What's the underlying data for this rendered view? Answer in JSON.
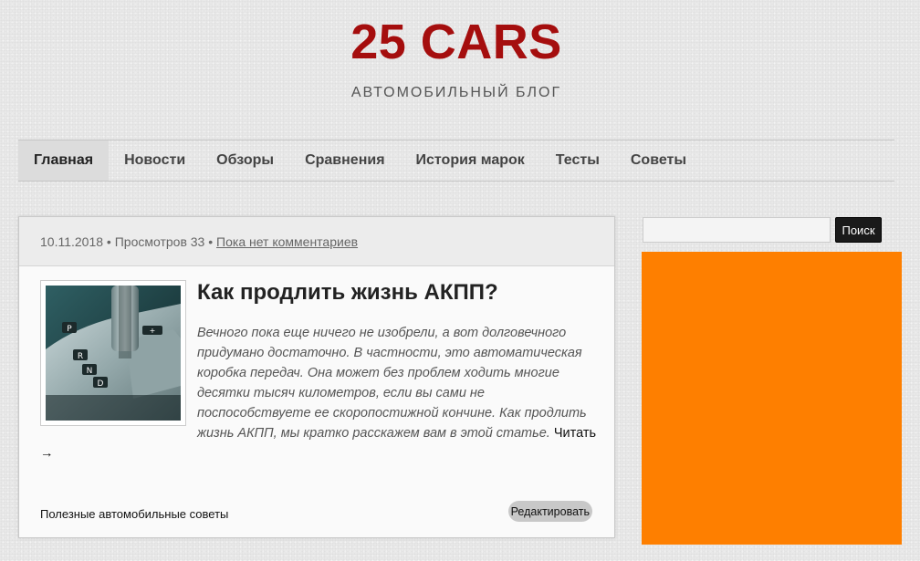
{
  "header": {
    "site_title": "25 CARS",
    "site_description": "АВТОМОБИЛЬНЫЙ БЛОГ"
  },
  "nav": {
    "items": [
      {
        "label": "Главная",
        "active": true
      },
      {
        "label": "Новости",
        "active": false
      },
      {
        "label": "Обзоры",
        "active": false
      },
      {
        "label": "Сравнения",
        "active": false
      },
      {
        "label": "История марок",
        "active": false
      },
      {
        "label": "Тесты",
        "active": false
      },
      {
        "label": "Советы",
        "active": false
      }
    ]
  },
  "post": {
    "date": "10.11.2018",
    "views_text": "Просмотров 33",
    "separator": "•",
    "comments_link": "Пока нет комментариев",
    "title": "Как продлить жизнь АКПП?",
    "excerpt": "Вечного пока еще ничего не изобрели, а вот долговечного придумано достаточно. В частности, это автоматическая коробка передач. Она может без проблем ходить многие десятки тысяч километров, если вы сами не поспособствуете ее скоропостижной кончине. Как продлить жизнь АКПП, мы кратко расскажем вам в этой статье.",
    "read_more": "Читать →",
    "category": "Полезные автомобильные советы",
    "edit_label": "Редактировать",
    "thumbnail_icon": "gear-shifter-image"
  },
  "sidebar": {
    "search_placeholder": "",
    "search_button": "Поиск",
    "ad_color": "#fe7f00"
  },
  "colors": {
    "title_red": "#a50e0e",
    "accent_orange": "#fe7f00"
  }
}
